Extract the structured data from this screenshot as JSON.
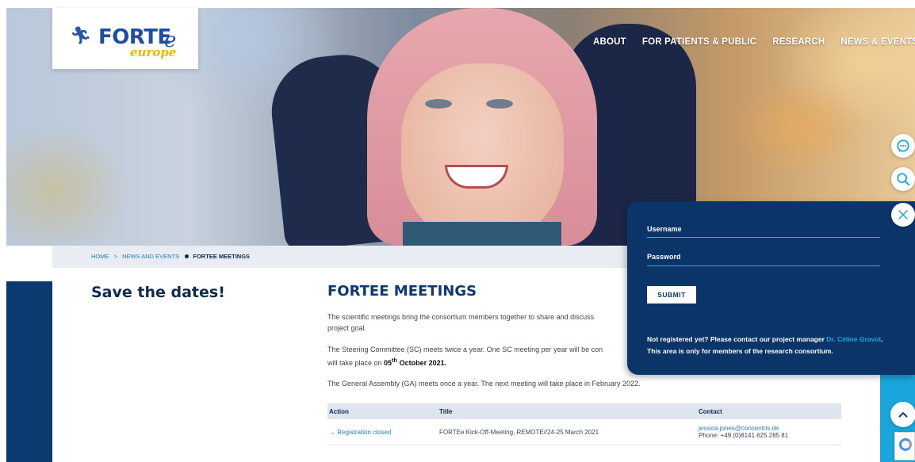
{
  "brand": {
    "logo_main": "FORTE",
    "logo_suffix": "e",
    "logo_sub": "europe"
  },
  "nav": {
    "items": [
      {
        "label": "ABOUT"
      },
      {
        "label": "FOR PATIENTS & PUBLIC"
      },
      {
        "label": "RESEARCH"
      },
      {
        "label": "NEWS & EVENTS"
      }
    ]
  },
  "breadcrumb": {
    "home": "HOME",
    "sep": ">",
    "parent": "NEWS AND EVENTS",
    "current": "FORTEE MEETINGS"
  },
  "sidebar": {
    "title": "Save the dates!"
  },
  "main": {
    "title": "FORTEE MEETINGS",
    "para1_line1": "The scientific meetings bring the consortium members together to share and discuss",
    "para1_line2": "project goal.",
    "para2_line1": "The Steering Committee (SC) meets twice a year. One SC meeting per year will be con",
    "para2_line2_prefix": "will take place on ",
    "para2_date_day": "05",
    "para2_date_sup": "th",
    "para2_date_rest": " October 2021.",
    "para3": "The General Assembly (GA) meets once a year. The next meeting will take place in February 2022."
  },
  "table": {
    "headers": {
      "action": "Action",
      "title": "Title",
      "contact": "Contact"
    },
    "rows": [
      {
        "action": "→ Registration closed",
        "title": "FORTEe Kick-Off-Meeting, REMOTE//24-25 March 2021",
        "email": "jessica.jones@concentris.de",
        "phone": "Phone: +49 (0)8141 625 285 81"
      }
    ]
  },
  "login": {
    "username_label": "Username",
    "password_label": "Password",
    "submit_label": "SUBMIT",
    "note_prefix": "Not registered yet? Please contact our project manager ",
    "note_link": "Dr. Céline Gravot",
    "note_suffix": ". This area is only for members of the research consortium."
  },
  "icons": {
    "chat": "chat-icon",
    "search": "search-icon",
    "close": "close-icon",
    "scroll_top": "chevron-up-icon",
    "recaptcha": "recaptcha-icon"
  },
  "colors": {
    "navy": "#0b3468",
    "accent": "#1aa6dc",
    "logo_yellow": "#f3b600"
  }
}
